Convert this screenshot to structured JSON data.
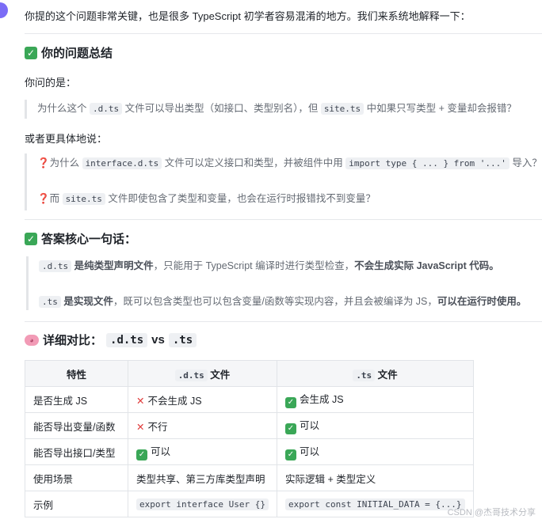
{
  "intro": "你提的这个问题非常关键，也是很多 TypeScript 初学者容易混淆的地方。我们来系统地解释一下：",
  "summary": {
    "heading": "你的问题总结",
    "asked_label": "你问的是：",
    "q1": {
      "pre": "为什么这个 ",
      "code1": ".d.ts",
      "mid": " 文件可以导出类型（如接口、类型别名），但 ",
      "code2": "site.ts",
      "post": " 中如果只写类型 + 变量却会报错？"
    },
    "more_specific": "或者更具体地说：",
    "q2": {
      "mark": "❓",
      "pre": "为什么 ",
      "code1": "interface.d.ts",
      "mid": " 文件可以定义接口和类型，并被组件中用 ",
      "code2": "import type { ... } from '...'",
      "post": " 导入？"
    },
    "q3": {
      "mark": "❓",
      "pre": "而 ",
      "code1": "site.ts",
      "post": " 文件即使包含了类型和变量，也会在运行时报错找不到变量？"
    }
  },
  "core": {
    "heading": "答案核心一句话：",
    "a1": {
      "code": ".d.ts",
      "b1": " 是纯类型声明文件",
      "mid": "，只能用于 TypeScript 编译时进行类型检查，",
      "b2": "不会生成实际 JavaScript 代码。"
    },
    "a2": {
      "code": ".ts",
      "b1": " 是实现文件",
      "mid": "，既可以包含类型也可以包含变量/函数等实现内容，并且会被编译为 JS，",
      "b2": "可以在运行时使用。"
    }
  },
  "compare": {
    "heading_pre": "详细对比：",
    "code1": ".d.ts",
    "vs": " vs ",
    "code2": ".ts",
    "headers": {
      "feature": "特性",
      "dts_code": ".d.ts",
      "dts_suffix": " 文件",
      "ts_code": ".ts",
      "ts_suffix": " 文件"
    },
    "rows": [
      {
        "feature": "是否生成 JS",
        "dts_icon": "cross",
        "dts": "不会生成 JS",
        "ts_icon": "check",
        "ts": "会生成 JS"
      },
      {
        "feature": "能否导出变量/函数",
        "dts_icon": "cross",
        "dts": "不行",
        "ts_icon": "check",
        "ts": "可以"
      },
      {
        "feature": "能否导出接口/类型",
        "dts_icon": "check",
        "dts": "可以",
        "ts_icon": "check",
        "ts": "可以"
      },
      {
        "feature": "使用场景",
        "dts": "类型共享、第三方库类型声明",
        "ts": "实际逻辑 + 类型定义"
      },
      {
        "feature": "示例",
        "dts_code": "export interface User {}",
        "ts_code": "export const INITIAL_DATA = {...}"
      }
    ]
  },
  "watermark": "CSDN @杰哥技术分享",
  "colors": {
    "check_green": "#3aa757",
    "cross_red": "#e03a3a",
    "question_red": "#d3343c",
    "avatar": "#7b6cf6"
  }
}
